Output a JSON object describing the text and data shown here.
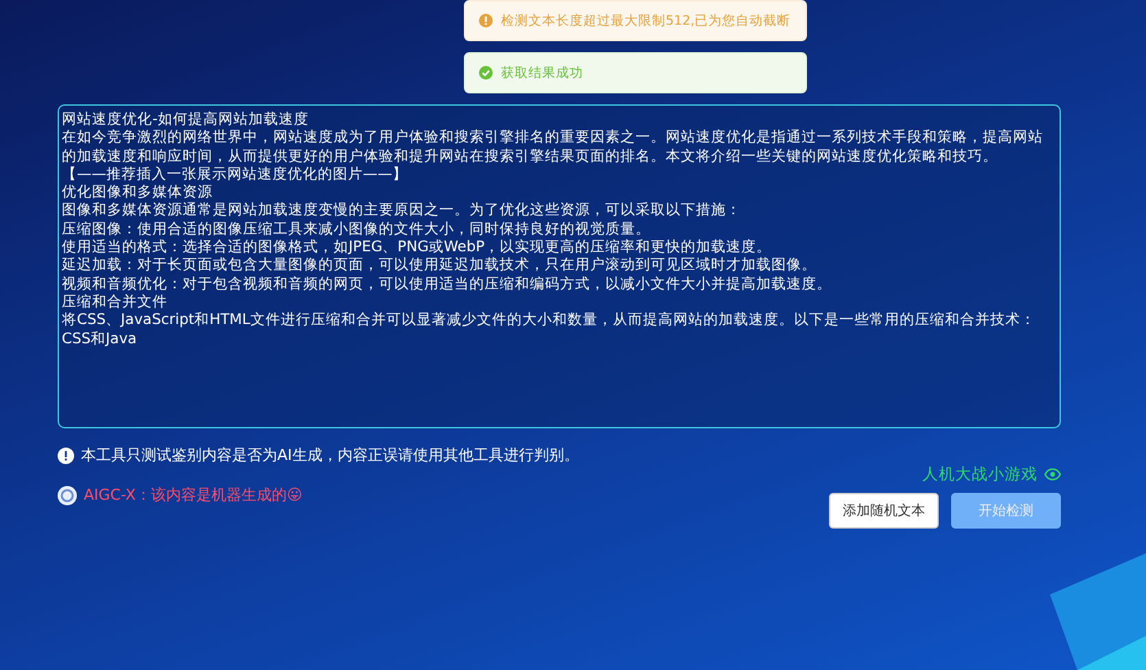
{
  "toasts": [
    {
      "kind": "warning",
      "text": "检测文本长度超过最大限制512,已为您自动截断"
    },
    {
      "kind": "success",
      "text": "获取结果成功"
    }
  ],
  "text_input": {
    "lines": [
      "网站速度优化-如何提高网站加载速度",
      "在如今竞争激烈的网络世界中，网站速度成为了用户体验和搜索引擎排名的重要因素之一。网站速度优化是指通过一系列技术手段和策略，提高网站的加载速度和响应时间，从而提供更好的用户体验和提升网站在搜索引擎结果页面的排名。本文将介绍一些关键的网站速度优化策略和技巧。",
      "【——推荐插入一张展示网站速度优化的图片——】",
      "优化图像和多媒体资源",
      "图像和多媒体资源通常是网站加载速度变慢的主要原因之一。为了优化这些资源，可以采取以下措施：",
      "压缩图像：使用合适的图像压缩工具来减小图像的文件大小，同时保持良好的视觉质量。",
      "使用适当的格式：选择合适的图像格式，如JPEG、PNG或WebP，以实现更高的压缩率和更快的加载速度。",
      "延迟加载：对于长页面或包含大量图像的页面，可以使用延迟加载技术，只在用户滚动到可见区域时才加载图像。",
      "视频和音频优化：对于包含视频和音频的网页，可以使用适当的压缩和编码方式，以减小文件大小并提高加载速度。",
      "压缩和合并文件",
      "将CSS、JavaScript和HTML文件进行压缩和合并可以显著减少文件的大小和数量，从而提高网站的加载速度。以下是一些常用的压缩和合并技术：",
      "CSS和Java"
    ]
  },
  "notice": "本工具只测试鉴别内容是否为AI生成，内容正误请使用其他工具进行判别。",
  "result": "AIGC-X：该内容是机器生成的😛",
  "game_link": "人机大战小游戏",
  "buttons": [
    {
      "label": "添加随机文本",
      "kind": "default"
    },
    {
      "label": "开始检测",
      "kind": "primary"
    }
  ]
}
